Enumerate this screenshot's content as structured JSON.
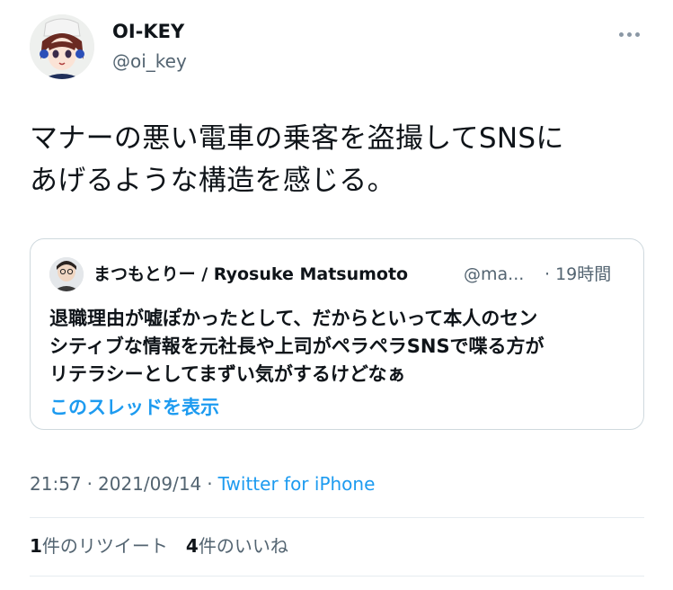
{
  "author": {
    "name": "OI-KEY",
    "handle": "@oi_key"
  },
  "tweet": {
    "lines": [
      "マナーの悪い電車の乗客を盗撮してSNSに",
      "あげるような構造を感じる。"
    ]
  },
  "quote": {
    "name": "まつもとりー / Ryosuke Matsumoto",
    "handle": "@ma...",
    "time": "· 19時間",
    "lines": [
      "退職理由が嘘ぽかったとして、だからといって本人のセン",
      "シティブな情報を元社長や上司がペラペラSNSで喋る方が",
      "リテラシーとしてまずい気がするけどなぁ"
    ],
    "show_thread": "このスレッドを表示"
  },
  "meta": {
    "time": "21:57",
    "sep": "·",
    "date": "2021/09/14",
    "source": "Twitter for iPhone"
  },
  "stats": {
    "retweets_count": "1",
    "retweets_label": "件のリツイート",
    "likes_count": "4",
    "likes_label": "件のいいね"
  },
  "icons": {
    "more": "more-dots-icon"
  },
  "colors": {
    "accent": "#1d9bf0",
    "secondary_text": "#536471",
    "border": "#cfd9de"
  }
}
